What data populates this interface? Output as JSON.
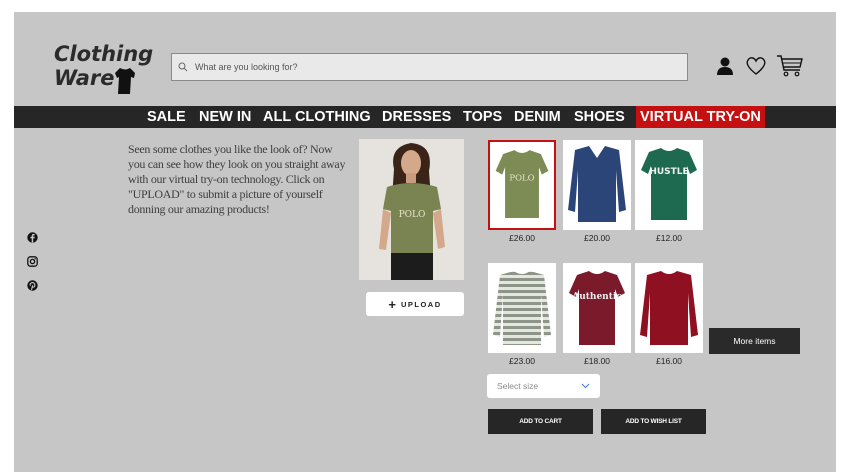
{
  "brand": {
    "line1": "Clothing",
    "line2": "Ware"
  },
  "search": {
    "placeholder": "What are you looking for?"
  },
  "header_icons": [
    "user-icon",
    "heart-icon",
    "cart-icon"
  ],
  "nav": {
    "items": [
      "SALE",
      "NEW IN",
      "ALL CLOTHING",
      "DRESSES",
      "TOPS",
      "DENIM",
      "SHOES",
      "VIRTUAL TRY-ON"
    ],
    "active": "VIRTUAL TRY-ON"
  },
  "social": [
    "facebook-icon",
    "instagram-icon",
    "pinterest-icon"
  ],
  "description": "Seen some clothes you like the look of? Now you can see how they look on you straight away with our virtual try-on technology. Click on \"UPLOAD\" to submit a picture of yourself donning our amazing products!",
  "model_tshirt_text": "POLO",
  "upload_label": "UPLOAD",
  "products": [
    {
      "price": "£26.00",
      "print": "POLO",
      "color": "#7d8c55",
      "selected": true
    },
    {
      "price": "£20.00",
      "print": "",
      "color": "#2c4579",
      "selected": false
    },
    {
      "price": "£12.00",
      "print": "HUSTLE",
      "color": "#1d6a50",
      "selected": false
    },
    {
      "price": "£23.00",
      "print": "",
      "color": "#b4b8b0",
      "selected": false
    },
    {
      "price": "£18.00",
      "print": "Authentic",
      "color": "#7a1a2a",
      "selected": false
    },
    {
      "price": "£16.00",
      "print": "",
      "color": "#8f1020",
      "selected": false
    }
  ],
  "more_items": "More items",
  "size_select": {
    "placeholder": "Select size"
  },
  "add_to_cart": "ADD TO CART",
  "add_to_wishlist": "ADD TO WISH LIST",
  "colors": {
    "nav_bg": "#262626",
    "accent": "#c41010",
    "page_bg": "#c6c6c6"
  }
}
